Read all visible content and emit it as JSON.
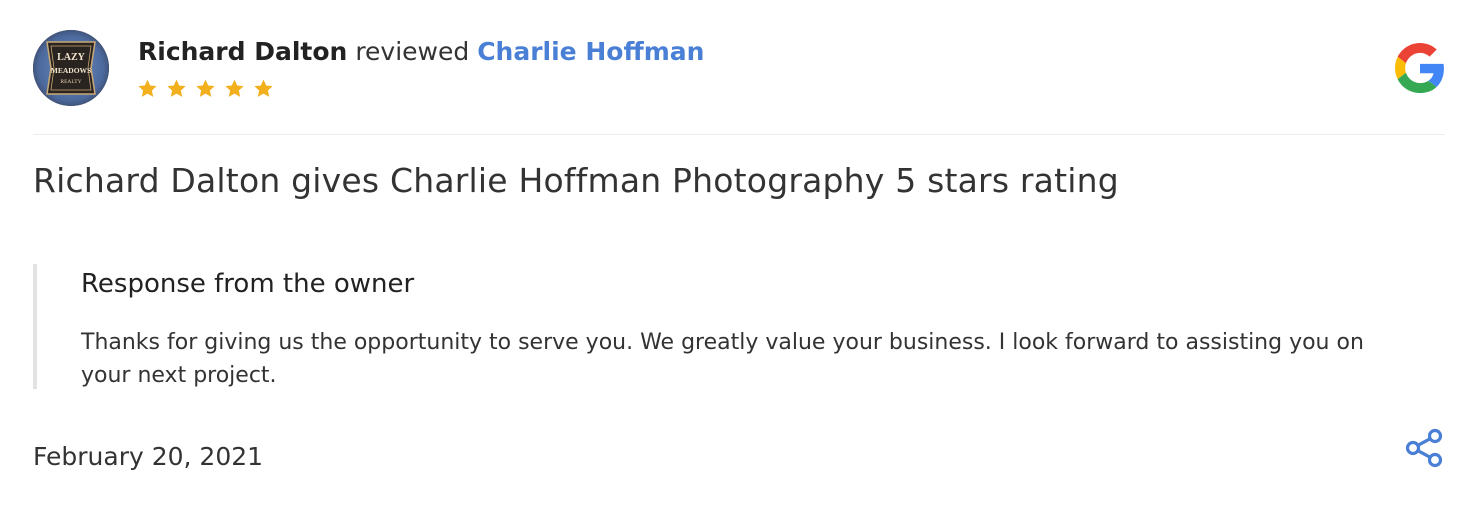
{
  "review": {
    "reviewer_name": "Richard Dalton",
    "action_word": "reviewed",
    "business_name": "Charlie Hoffman",
    "rating": 5,
    "rating_max": 5,
    "title": "Richard Dalton gives Charlie Hoffman Photography 5 stars rating",
    "date": "February 20, 2021"
  },
  "avatar": {
    "logo_lines": [
      "LAZY",
      "MEADOWS",
      "REALTY"
    ]
  },
  "owner_response": {
    "heading": "Response from the owner",
    "text": "Thanks for giving us the opportunity to serve you. We greatly value your business. I look forward to assisting you on your next project."
  },
  "icons": {
    "source": "google-icon",
    "share": "share-icon",
    "star": "star-icon"
  },
  "colors": {
    "link": "#4a7fd6",
    "star": "#f2b01e",
    "share": "#4a7fd6",
    "google_blue": "#4285F4",
    "google_red": "#EA4335",
    "google_yellow": "#FBBC05",
    "google_green": "#34A853"
  }
}
